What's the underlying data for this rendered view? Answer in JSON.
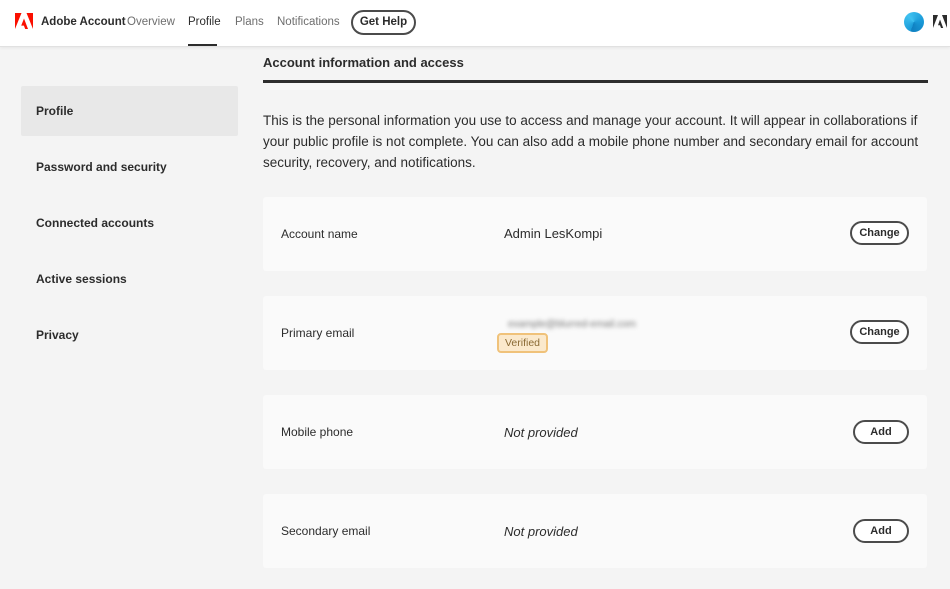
{
  "header": {
    "brand": "Adobe Account",
    "nav": [
      "Overview",
      "Profile",
      "Plans",
      "Notifications"
    ],
    "active_nav": "Profile",
    "help_label": "Get Help",
    "brand_color": "#fa0f00"
  },
  "sidebar": {
    "items": [
      {
        "label": "Profile",
        "active": true
      },
      {
        "label": "Password and security"
      },
      {
        "label": "Connected accounts"
      },
      {
        "label": "Active sessions"
      },
      {
        "label": "Privacy"
      }
    ]
  },
  "main": {
    "section_title": "Account information and access",
    "intro": "This is the personal information you use to access and manage your account. It will appear in collaborations if your public profile is not complete. You can also add a mobile phone number and secondary email for account security, recovery, and notifications.",
    "rows": [
      {
        "label": "Account name",
        "value": "Admin LesKompi",
        "action": "Change"
      },
      {
        "label": "Primary email",
        "value": "example@blurred-email.com",
        "badge": "Verified",
        "action": "Change"
      },
      {
        "label": "Mobile phone",
        "value": "Not provided",
        "action": "Add"
      },
      {
        "label": "Secondary email",
        "value": "Not provided",
        "action": "Add"
      }
    ]
  }
}
